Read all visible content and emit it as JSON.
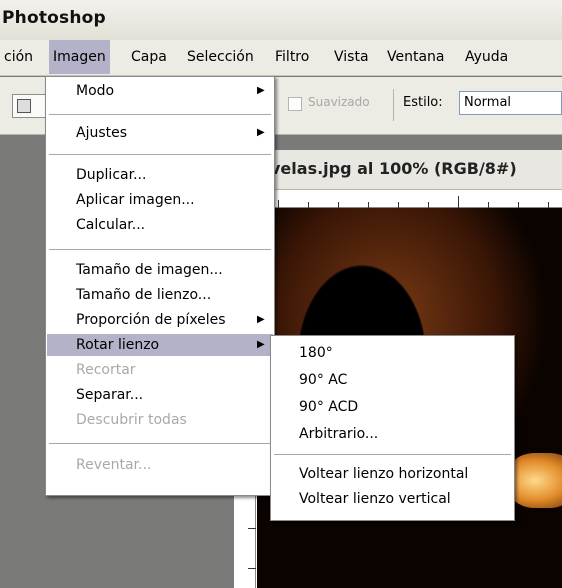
{
  "app": {
    "title": "Photoshop"
  },
  "menubar": {
    "items": [
      "ción",
      "Imagen",
      "Capa",
      "Selección",
      "Filtro",
      "Vista",
      "Ventana",
      "Ayuda"
    ]
  },
  "options": {
    "antialias_label": "Suavizado",
    "style_label": "Estilo:",
    "style_value": "Normal"
  },
  "document": {
    "title": "velas.jpg al 100% (RGB/8#)"
  },
  "imagen_menu": {
    "items": [
      {
        "label": "Modo",
        "submenu": true
      },
      {
        "label": "Ajustes",
        "submenu": true
      },
      {
        "label": "Duplicar..."
      },
      {
        "label": "Aplicar imagen..."
      },
      {
        "label": "Calcular..."
      },
      {
        "label": "Tamaño de imagen..."
      },
      {
        "label": "Tamaño de lienzo..."
      },
      {
        "label": "Proporción de píxeles",
        "submenu": true
      },
      {
        "label": "Rotar lienzo",
        "submenu": true,
        "highlighted": true
      },
      {
        "label": "Recortar",
        "disabled": true
      },
      {
        "label": "Separar..."
      },
      {
        "label": "Descubrir todas",
        "disabled": true
      },
      {
        "label": "Reventar...",
        "disabled": true
      }
    ],
    "submenu_arrow": "▶"
  },
  "rotar_submenu": {
    "items": [
      "180°",
      "90° AC",
      "90° ACD",
      "Arbitrario...",
      "Voltear lienzo horizontal",
      "Voltear lienzo vertical"
    ]
  }
}
